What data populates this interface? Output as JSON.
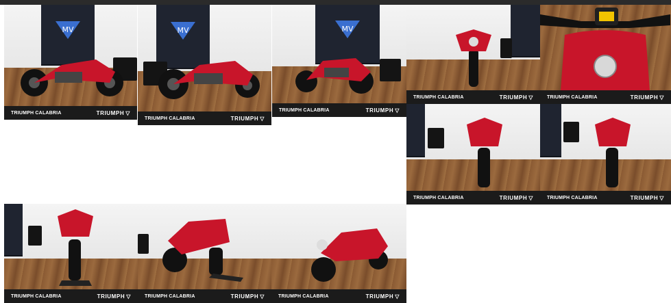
{
  "gallery": {
    "items": [
      {
        "dealer": "TRIUMPH CALABRIA",
        "brand": "TRIUMPH",
        "view": "side-left"
      },
      {
        "dealer": "TRIUMPH CALABRIA",
        "brand": "TRIUMPH",
        "view": "side-left-angled"
      },
      {
        "dealer": "TRIUMPH CALABRIA",
        "brand": "TRIUMPH",
        "view": "front-angled"
      },
      {
        "dealer": "TRIUMPH CALABRIA",
        "brand": "TRIUMPH",
        "view": "front"
      },
      {
        "dealer": "TRIUMPH CALABRIA",
        "brand": "TRIUMPH",
        "view": "tank-dash"
      },
      {
        "dealer": "TRIUMPH CALABRIA",
        "brand": "TRIUMPH",
        "view": "rear"
      },
      {
        "dealer": "TRIUMPH CALABRIA",
        "brand": "TRIUMPH",
        "view": "rear-2"
      },
      {
        "dealer": "TRIUMPH CALABRIA",
        "brand": "TRIUMPH",
        "view": "rear-stand"
      },
      {
        "dealer": "TRIUMPH CALABRIA",
        "brand": "TRIUMPH",
        "view": "rear-angled"
      },
      {
        "dealer": "TRIUMPH CALABRIA",
        "brand": "TRIUMPH",
        "view": "front-right"
      }
    ]
  },
  "colors": {
    "bike_red": "#c8152a",
    "caption_bg": "#1b1b1b",
    "banner": "#1f2430"
  },
  "icons": {
    "brand_mark": "triumph-shield-icon"
  }
}
